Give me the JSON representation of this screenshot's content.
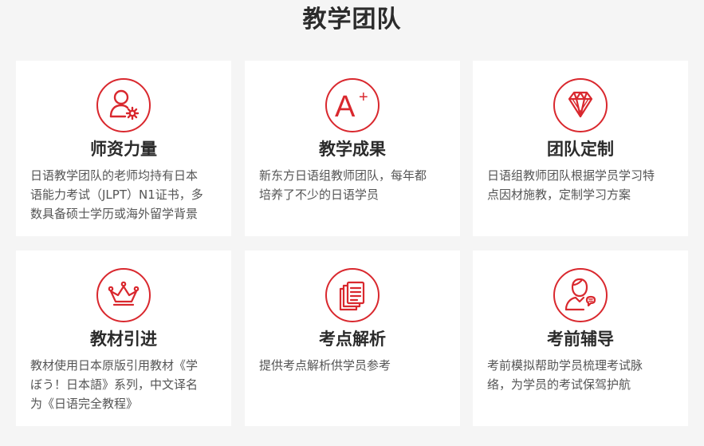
{
  "section": {
    "title": "教学团队"
  },
  "cards": [
    {
      "title": "师资力量",
      "desc": "日语教学团队的老师均持有日本\n语能力考试（JLPT）N1证书，多\n数具备硕士学历或海外留学背景",
      "icon": "teacher-gear-icon"
    },
    {
      "title": "教学成果",
      "desc": "新东方日语组教师团队，每年都\n培养了不少的日语学员",
      "icon": "a-plus-icon",
      "icon_text": "A",
      "icon_sup": "+"
    },
    {
      "title": "团队定制",
      "desc": "日语组教师团队根据学员学习特\n点因材施教，定制学习方案",
      "icon": "diamond-icon"
    },
    {
      "title": "教材引进",
      "desc": "教材使用日本原版引用教材《学\nぼう！日本語》系列，中文译名\n为《日语完全教程》",
      "icon": "crown-icon"
    },
    {
      "title": "考点解析",
      "desc": "提供考点解析供学员参考",
      "icon": "documents-icon"
    },
    {
      "title": "考前辅导",
      "desc": "考前模拟帮助学员梳理考试脉\n络，为学员的考试保驾护航",
      "icon": "tutor-chat-icon"
    }
  ],
  "colors": {
    "accent": "#d9282e",
    "background": "#f5f5f5",
    "card": "#ffffff",
    "title": "#2b2b2b",
    "text": "#555555"
  }
}
